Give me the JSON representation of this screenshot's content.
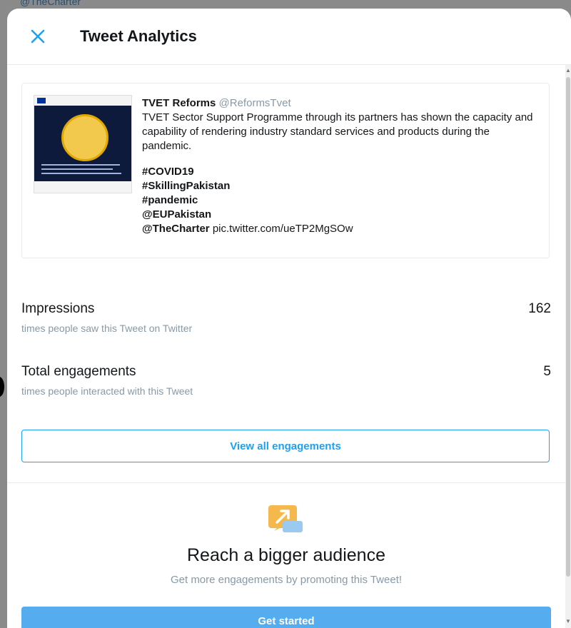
{
  "backdrop": {
    "partial_text": "@TheCharter"
  },
  "header": {
    "title": "Tweet Analytics",
    "close_icon": "close-icon"
  },
  "tweet": {
    "author": "TVET Reforms",
    "handle": "@ReformsTvet",
    "body": "TVET Sector Support Programme through its partners has shown the capacity and capability of rendering industry standard services and products during the pandemic.",
    "tags": [
      "#COVID19",
      "#SkillingPakistan",
      "#pandemic",
      "@EUPakistan",
      "@TheCharter"
    ],
    "pic_link": "pic.twitter.com/ueTP2MgSOw"
  },
  "metrics": [
    {
      "label": "Impressions",
      "desc": "times people saw this Tweet on Twitter",
      "value": "162"
    },
    {
      "label": "Total engagements",
      "desc": "times people interacted with this Tweet",
      "value": "5"
    }
  ],
  "view_all_label": "View all engagements",
  "promo": {
    "icon": "promote-icon",
    "title": "Reach a bigger audience",
    "desc": "Get more engagements by promoting this Tweet!",
    "button_label": "Get started"
  },
  "colors": {
    "accent": "#1da1f2",
    "button_bg": "#55acee",
    "muted": "#8899a6",
    "icon_orange": "#f5b84d"
  }
}
